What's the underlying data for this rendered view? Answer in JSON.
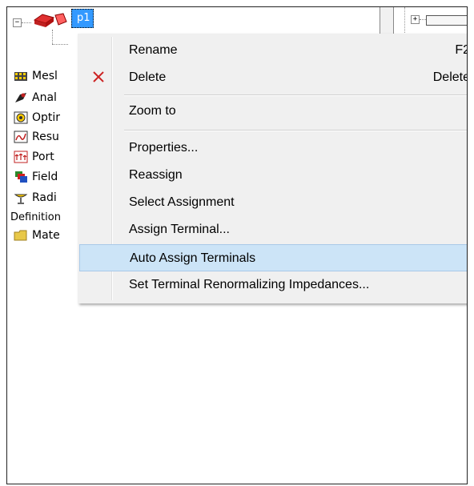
{
  "tree": {
    "selected_node": "p1",
    "items": [
      {
        "label": "Mesl",
        "icon": "mesh-icon"
      },
      {
        "label": "Anal",
        "icon": "analysis-icon"
      },
      {
        "label": "Optir",
        "icon": "optimetrics-icon"
      },
      {
        "label": "Resu",
        "icon": "results-icon"
      },
      {
        "label": "Port",
        "icon": "port-field-display-icon"
      },
      {
        "label": "Field",
        "icon": "field-overlays-icon"
      },
      {
        "label": "Radi",
        "icon": "radiation-icon"
      },
      {
        "label": "Definition",
        "icon": ""
      },
      {
        "label": "Mate",
        "icon": "folder-icon"
      }
    ]
  },
  "context_menu": {
    "items": [
      {
        "label": "Rename",
        "shortcut": "F2"
      },
      {
        "label": "Delete",
        "shortcut": "Delete",
        "icon": "delete-x-icon"
      },
      {
        "label": "Zoom to",
        "shortcut": ""
      },
      {
        "label": "Properties...",
        "shortcut": ""
      },
      {
        "label": "Reassign",
        "shortcut": ""
      },
      {
        "label": "Select Assignment",
        "shortcut": ""
      },
      {
        "label": "Assign Terminal...",
        "shortcut": ""
      },
      {
        "label": "Auto Assign Terminals",
        "shortcut": "",
        "highlighted": true
      },
      {
        "label": "Set Terminal Renormalizing Impedances...",
        "shortcut": ""
      }
    ]
  },
  "colors": {
    "selection": "#3399ff",
    "menu_highlight": "#cce4f7",
    "menu_background": "#f0f0f0",
    "delete_icon": "#cc2222"
  }
}
